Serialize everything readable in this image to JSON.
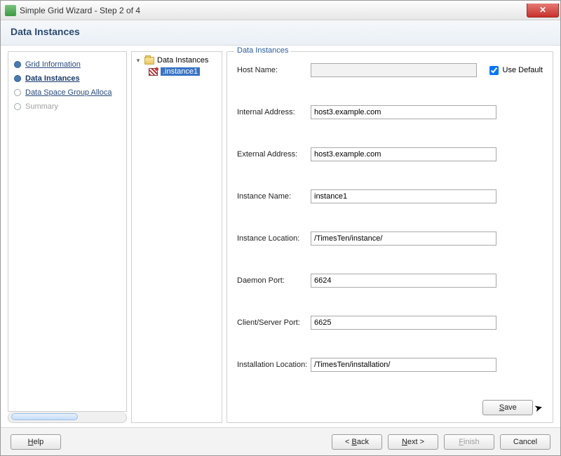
{
  "window": {
    "title": "Simple Grid Wizard - Step 2 of 4"
  },
  "header": {
    "title": "Data Instances"
  },
  "steps": {
    "grid_info": "Grid Information",
    "data_instances": "Data Instances",
    "data_space": "Data Space Group Alloca",
    "summary": "Summary"
  },
  "tree": {
    "root": "Data Instances",
    "child": ".instance1"
  },
  "form": {
    "legend": "Data Instances",
    "host_name_label": "Host Name:",
    "host_name_value": "",
    "use_default_label": "Use Default",
    "internal_addr_label": "Internal Address:",
    "internal_addr_value": "host3.example.com",
    "external_addr_label": "External Address:",
    "external_addr_value": "host3.example.com",
    "instance_name_label": "Instance Name:",
    "instance_name_value": "instance1",
    "instance_loc_label": "Instance Location:",
    "instance_loc_value": "/TimesTen/instance/",
    "daemon_port_label": "Daemon Port:",
    "daemon_port_value": "6624",
    "cs_port_label": "Client/Server Port:",
    "cs_port_value": "6625",
    "install_loc_label": "Installation Location:",
    "install_loc_value": "/TimesTen/installation/",
    "save_label": "Save"
  },
  "footer": {
    "help": "Help",
    "back": "< Back",
    "next": "Next >",
    "finish": "Finish",
    "cancel": "Cancel"
  }
}
